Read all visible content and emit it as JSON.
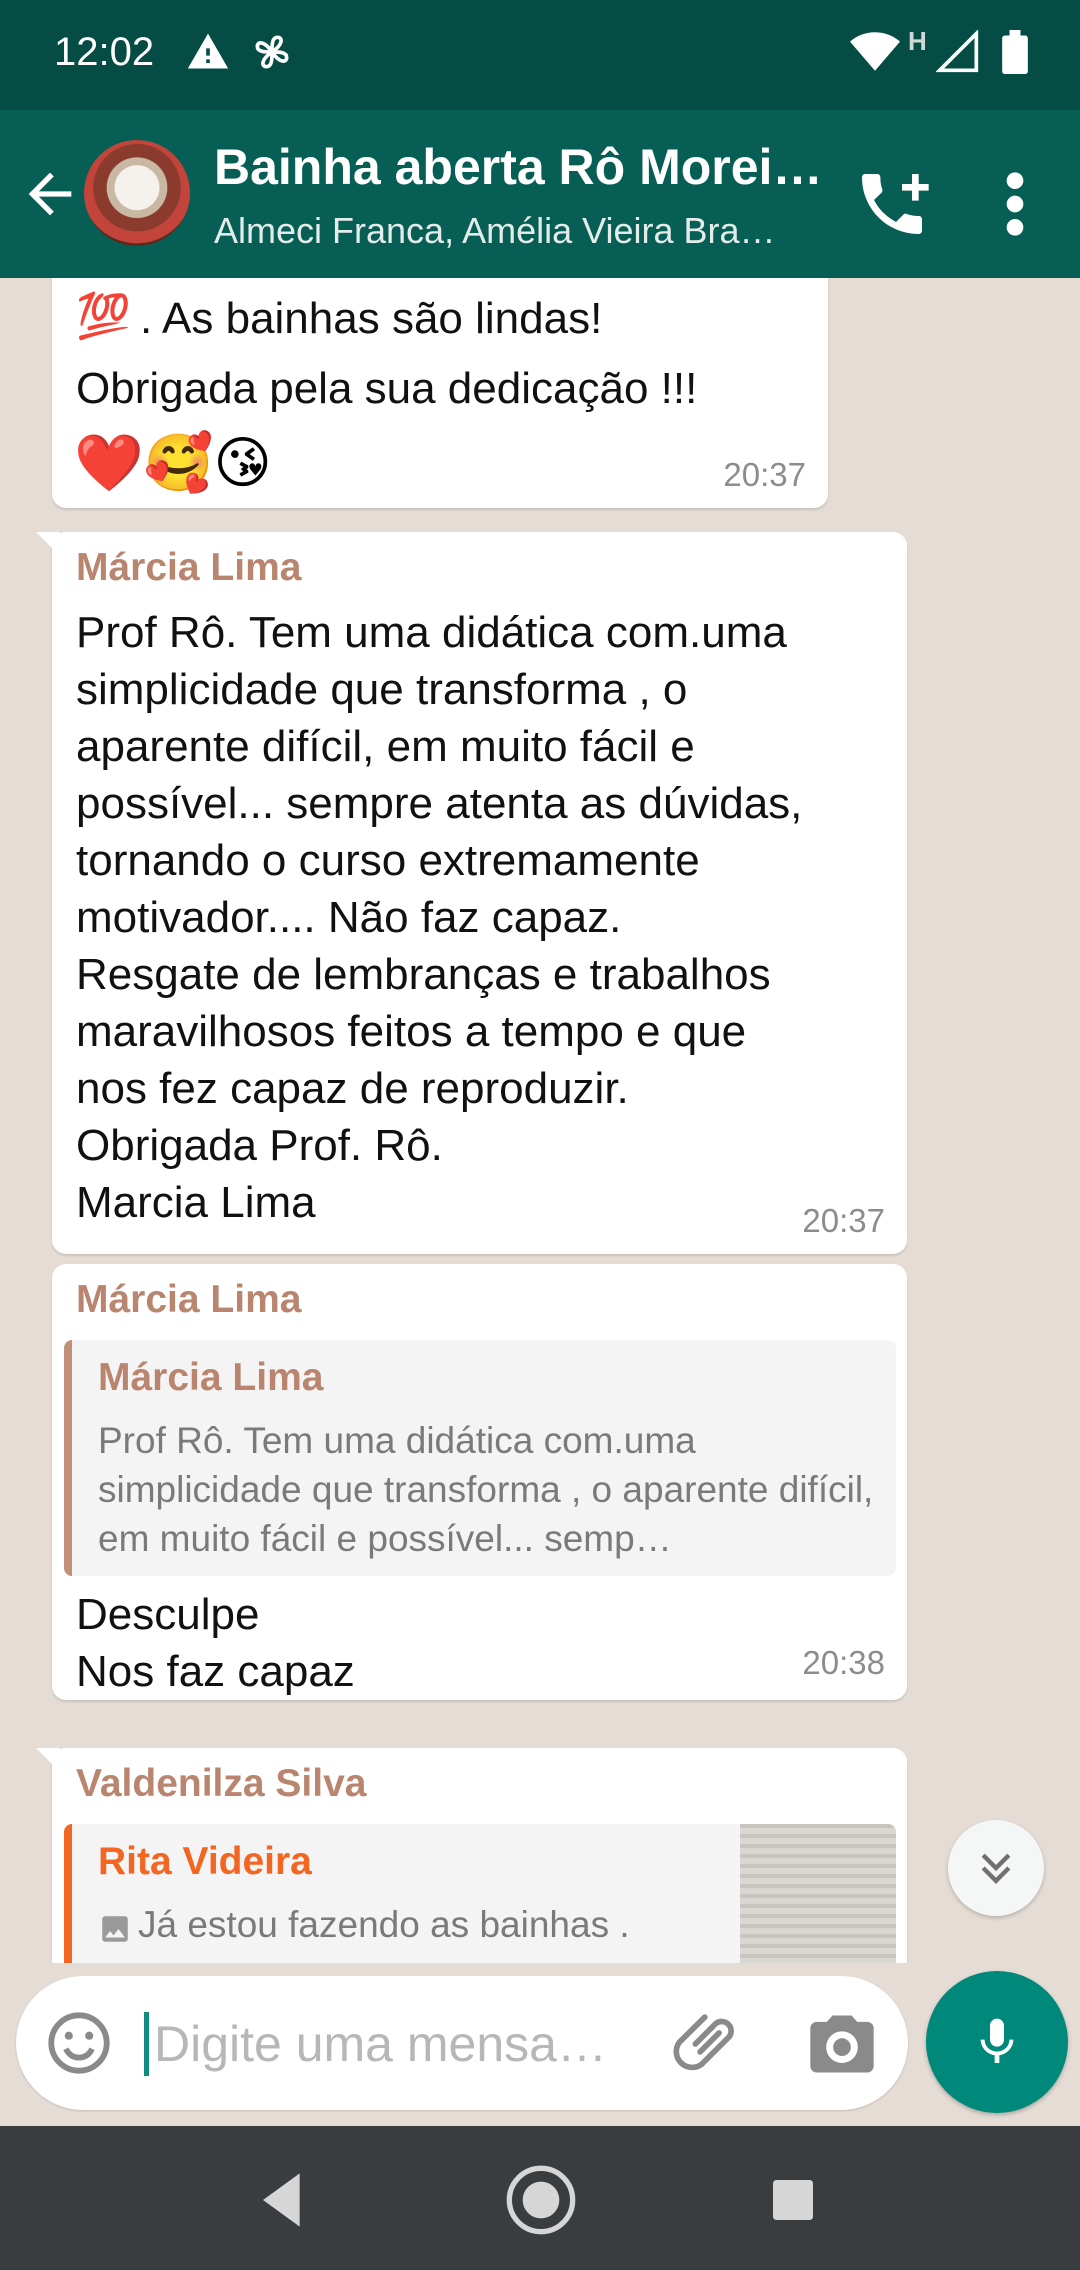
{
  "status_bar": {
    "time": "12:02",
    "network_label": "H"
  },
  "header": {
    "title": "Bainha aberta Rô Morei…",
    "subtitle": "Almeci Franca, Amélia Vieira Bra…"
  },
  "messages": [
    {
      "text_prefix": ".  As bainhas são lindas!",
      "text": "Obrigada pela sua dedicação !!!",
      "emoji_100": "💯",
      "emojis": "❤️🥰😘",
      "time": "20:37"
    },
    {
      "sender": "Márcia Lima",
      "text": "Prof Rô. Tem uma didática com.uma\nsimplicidade que transforma , o\naparente difícil,  em muito fácil e\npossível... sempre atenta as dúvidas,\ntornando o curso extremamente\nmotivador.... Não faz capaz.\nResgate de lembranças e trabalhos\nmaravilhosos feitos a tempo e que\nnos fez capaz de reproduzir.\nObrigada Prof. Rô.\nMarcia Lima",
      "time": "20:37"
    },
    {
      "sender": "Márcia Lima",
      "quote_sender": "Márcia Lima",
      "quote_text": "Prof Rô. Tem uma didática com.uma simplicidade que transforma , o aparente difícil,  em muito fácil e possível... semp…",
      "text": "Desculpe\nNos faz capaz",
      "time": "20:38"
    },
    {
      "sender": "Valdenilza Silva",
      "quote_sender": "Rita Videira",
      "quote_text": "Já estou fazendo as bainhas ."
    }
  ],
  "composer": {
    "placeholder": "Digite uma mensa…"
  },
  "colors": {
    "header": "#075e54",
    "status_bar": "#054d44",
    "accent": "#00897b",
    "sender_name": "#b9856f",
    "quote_sender_orange": "#f26522"
  }
}
